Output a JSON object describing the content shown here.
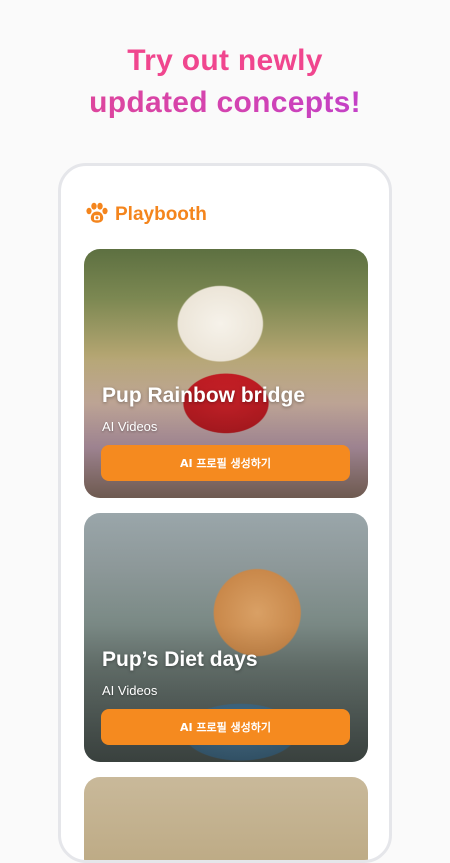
{
  "headline": {
    "line1": "Try out newly",
    "line2": "updated concepts!"
  },
  "app": {
    "brand": "Playbooth",
    "brand_icon": "paw-icon",
    "accent_color": "#F58A1F"
  },
  "cards": [
    {
      "title": "Pup Rainbow bridge",
      "subtitle": "AI Videos",
      "button_label": "AI 프로필 생성하기"
    },
    {
      "title": "Pup’s Diet days",
      "subtitle": "AI Videos",
      "button_label": "AI 프로필 생성하기"
    }
  ]
}
